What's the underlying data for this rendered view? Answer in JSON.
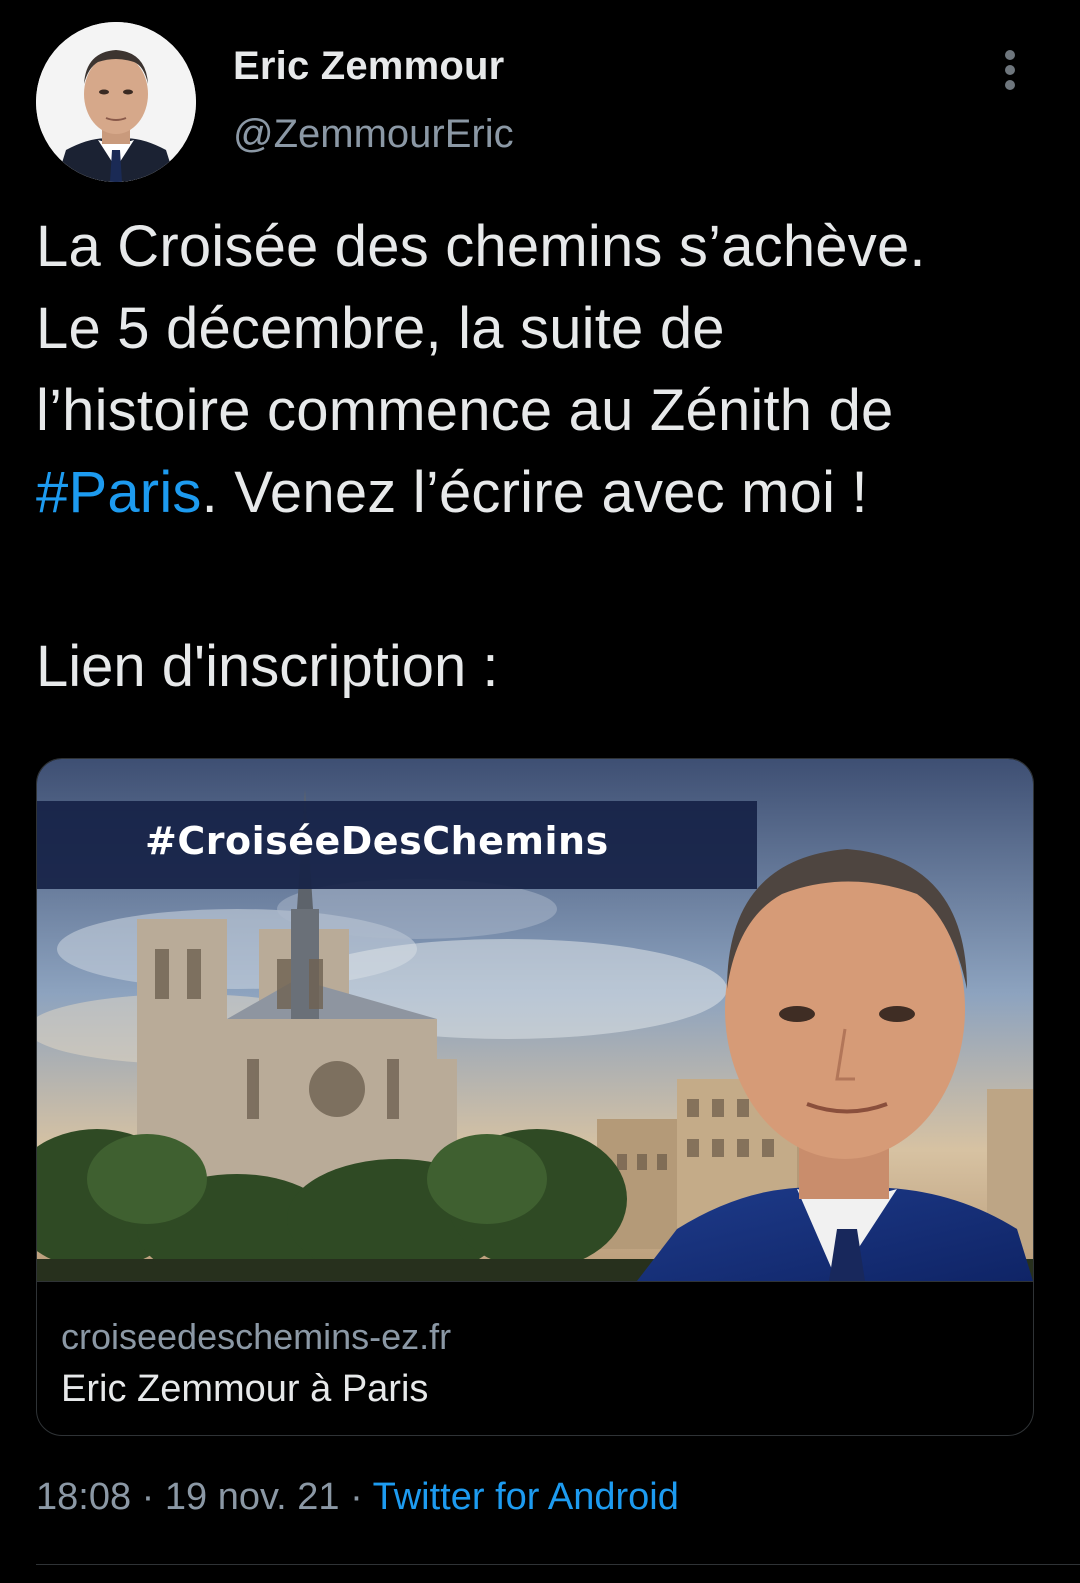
{
  "author": {
    "name": "Eric Zemmour",
    "handle": "@ZemmourEric"
  },
  "tweet": {
    "lines": [
      "La Croisée des chemins s’achève.",
      "Le 5 décembre, la suite de",
      "l’histoire commence au Zénith de"
    ],
    "hashtag": "#Paris",
    "line4_rest": ". Venez l’écrire avec moi !",
    "subtext": "Lien d'inscription :"
  },
  "card": {
    "image_hashtag": "#CroiséeDesChemins",
    "domain": "croiseedeschemins-ez.fr",
    "title": "Eric Zemmour à Paris"
  },
  "meta": {
    "time": "18:08",
    "separator": " · ",
    "date": "19 nov. 21",
    "source": "Twitter for Android"
  },
  "colors": {
    "background": "#000000",
    "text": "#e7e9ea",
    "secondary": "#8b98a5",
    "link": "#1d9bf0"
  }
}
